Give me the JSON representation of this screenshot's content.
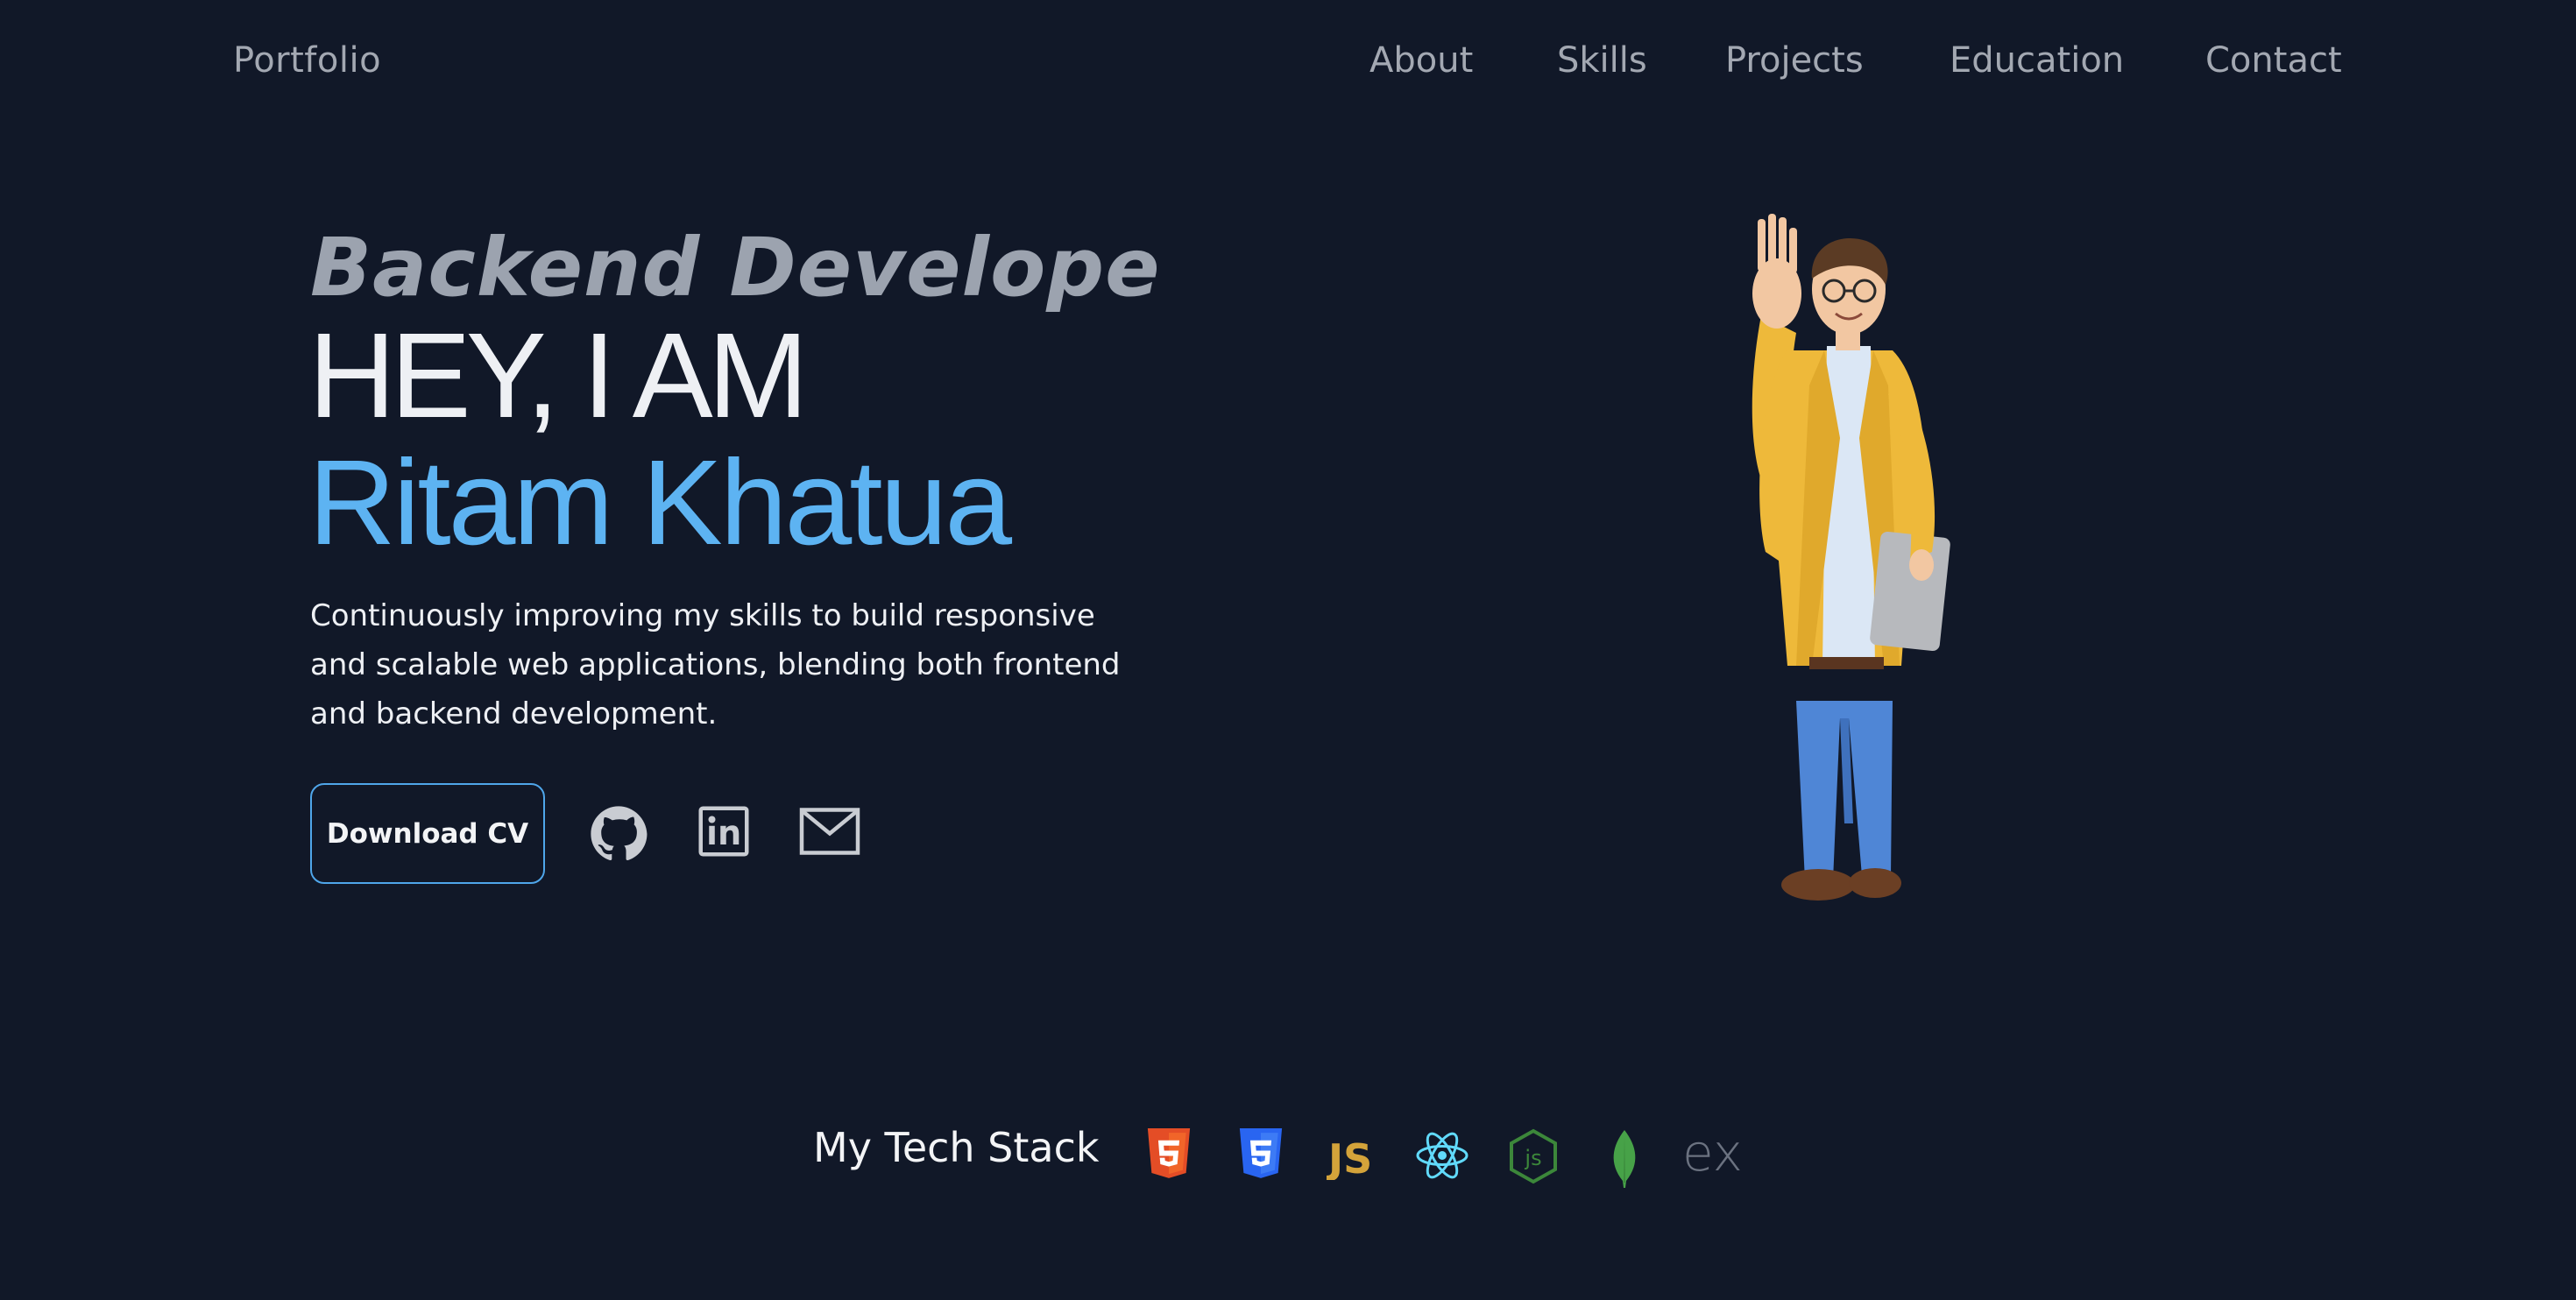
{
  "nav": {
    "brand": "Portfolio",
    "links": [
      {
        "label": "About"
      },
      {
        "label": "Skills"
      },
      {
        "label": "Projects"
      },
      {
        "label": "Education"
      },
      {
        "label": "Contact"
      }
    ]
  },
  "hero": {
    "role": "Backend Develope",
    "greeting": "HEY, I AM",
    "name": "Ritam Khatua",
    "description": "Continuously improving my skills to build responsive and scalable web applications, blending both frontend and backend development.",
    "cv_button": "Download CV",
    "socials": [
      {
        "icon": "github-icon"
      },
      {
        "icon": "linkedin-icon"
      },
      {
        "icon": "mail-icon"
      }
    ],
    "illustration": "waving-developer-avatar"
  },
  "tech_stack": {
    "title": "My Tech Stack",
    "items": [
      {
        "icon": "html5-icon",
        "color": "#e44d26"
      },
      {
        "icon": "css3-icon",
        "color": "#2965f1"
      },
      {
        "icon": "javascript-icon",
        "label": "JS",
        "color": "#d4a33a"
      },
      {
        "icon": "react-icon",
        "color": "#61dafb"
      },
      {
        "icon": "nodejs-icon",
        "label": "js",
        "color": "#3c873a"
      },
      {
        "icon": "mongodb-icon",
        "color": "#47a248"
      },
      {
        "icon": "express-icon",
        "label": "ex",
        "color": "#6b7280"
      }
    ]
  },
  "colors": {
    "background": "#111828",
    "accent": "#5db3f2",
    "muted": "#a3a8b2",
    "text": "#eef0f4"
  }
}
